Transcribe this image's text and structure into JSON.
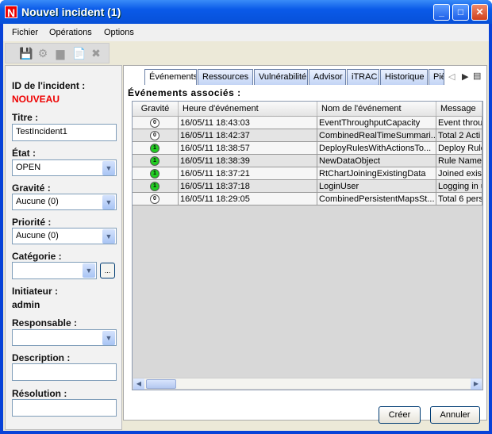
{
  "window": {
    "title": "Nouvel incident (1)",
    "logo": "N"
  },
  "menu": [
    "Fichier",
    "Opérations",
    "Options"
  ],
  "toolbar": [
    "save-icon",
    "gear-icon",
    "panel-icon",
    "edit-document-icon",
    "delete-icon"
  ],
  "form": {
    "id_label": "ID de l'incident :",
    "id_value": "NOUVEAU",
    "titre_label": "Titre :",
    "titre_value": "TestIncident1",
    "etat_label": "État :",
    "etat_value": "OPEN",
    "gravite_label": "Gravité :",
    "gravite_value": "Aucune (0)",
    "priorite_label": "Priorité :",
    "priorite_value": "Aucune (0)",
    "categorie_label": "Catégorie :",
    "categorie_value": "",
    "categorie_button": "...",
    "initiateur_label": "Initiateur :",
    "initiateur_value": "admin",
    "responsable_label": "Responsable :",
    "responsable_value": "",
    "description_label": "Description :",
    "description_value": "",
    "resolution_label": "Résolution :",
    "resolution_value": ""
  },
  "tabs": [
    "Événements",
    "Ressources",
    "Vulnérabilité",
    "Advisor",
    "iTRAC",
    "Historique",
    "Piè"
  ],
  "section_title": "Événements associés :",
  "table": {
    "columns": [
      "Gravité",
      "Heure d'événement",
      "Nom de l'événement",
      "Message"
    ],
    "rows": [
      {
        "sev": "0",
        "time": "16/05/11 18:43:03",
        "name": "EventThroughputCapacity",
        "msg": "Event throu"
      },
      {
        "sev": "0",
        "time": "16/05/11 18:42:37",
        "name": "CombinedRealTimeSummari...",
        "msg": "Total 2 Acti"
      },
      {
        "sev": "1",
        "time": "16/05/11 18:38:57",
        "name": "DeployRulesWithActionsTo...",
        "msg": "Deploy Rule"
      },
      {
        "sev": "1",
        "time": "16/05/11 18:38:39",
        "name": "NewDataObject",
        "msg": "Rule Name"
      },
      {
        "sev": "1",
        "time": "16/05/11 18:37:21",
        "name": "RtChartJoiningExistingData",
        "msg": "Joined exis"
      },
      {
        "sev": "1",
        "time": "16/05/11 18:37:18",
        "name": "LoginUser",
        "msg": "Logging in u"
      },
      {
        "sev": "0",
        "time": "16/05/11 18:29:05",
        "name": "CombinedPersistentMapsSt...",
        "msg": "Total 6 pers"
      }
    ]
  },
  "buttons": {
    "create": "Créer",
    "cancel": "Annuler"
  },
  "colors": {
    "sev0": "#ffffff",
    "sev1": "#22cc22",
    "id": "#ee0000"
  }
}
